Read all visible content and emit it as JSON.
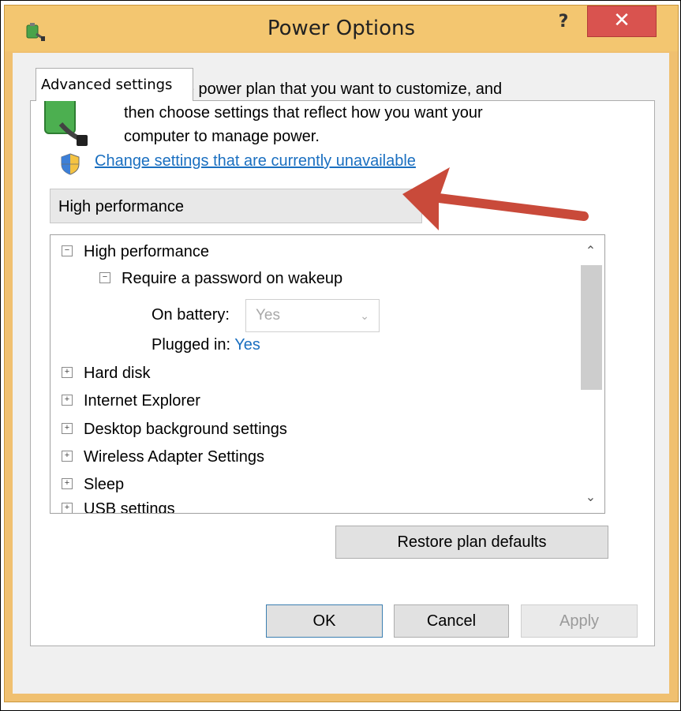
{
  "window": {
    "title": "Power Options",
    "help_label": "?",
    "close_label": "✕",
    "accent_color": "#f3c670",
    "close_color": "#d9534f"
  },
  "tabs": [
    {
      "label": "Advanced settings",
      "active": true
    }
  ],
  "description": {
    "line1": "Select the power plan that you want to customize, and",
    "line2": "then choose settings that reflect how you want your",
    "line3": "computer to manage power."
  },
  "change_link": {
    "label": "Change settings that are currently unavailable",
    "icon": "uac-shield-icon"
  },
  "plan_select": {
    "value": "High performance"
  },
  "tree": {
    "root": {
      "label": "High performance",
      "toggle": "−"
    },
    "password": {
      "label": "Require a password on wakeup",
      "toggle": "−"
    },
    "on_battery": {
      "label": "On battery:",
      "value": "Yes"
    },
    "plugged_in": {
      "label": "Plugged in:",
      "value": "Yes"
    },
    "items": [
      {
        "label": "Hard disk",
        "toggle": "+"
      },
      {
        "label": "Internet Explorer",
        "toggle": "+"
      },
      {
        "label": "Desktop background settings",
        "toggle": "+"
      },
      {
        "label": "Wireless Adapter Settings",
        "toggle": "+"
      },
      {
        "label": "Sleep",
        "toggle": "+"
      },
      {
        "label": "USB settings",
        "toggle": "+"
      }
    ]
  },
  "scrollbar": {
    "up": "⌃",
    "down": "⌄"
  },
  "buttons": {
    "restore": "Restore plan defaults",
    "ok": "OK",
    "cancel": "Cancel",
    "apply": "Apply"
  }
}
